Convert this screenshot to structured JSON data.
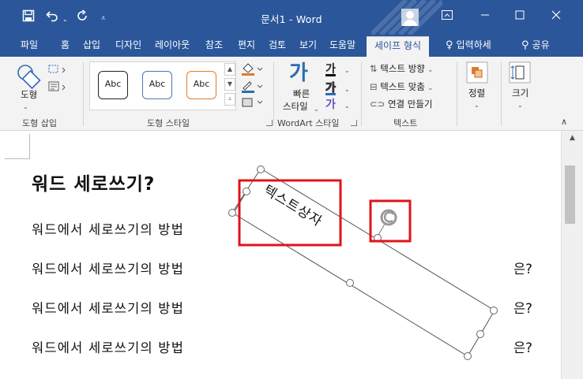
{
  "window": {
    "title": "문서1 - Word",
    "qat_icons": [
      "save-icon",
      "undo-icon",
      "redo-icon",
      "customize-qat-icon"
    ]
  },
  "tabs": [
    {
      "label": "파일"
    },
    {
      "label": "홈"
    },
    {
      "label": "삽입"
    },
    {
      "label": "디자인"
    },
    {
      "label": "레이아웃"
    },
    {
      "label": "참조"
    },
    {
      "label": "편지"
    },
    {
      "label": "검토"
    },
    {
      "label": "보기"
    },
    {
      "label": "도움말"
    },
    {
      "label": "세이프 형식",
      "active": true
    },
    {
      "label": "입력하세"
    },
    {
      "label": "공유"
    }
  ],
  "ribbon": {
    "insert_shapes": {
      "shape_label": "도형",
      "group_label": "도형 삽입"
    },
    "shape_styles": {
      "preset_labels": [
        "Abc",
        "Abc",
        "Abc"
      ],
      "group_label": "도형 스타일"
    },
    "wordart": {
      "quick_styles_label_line1": "빠른",
      "quick_styles_label_line2": "스타일",
      "text_fill_glyph": "가",
      "text_outline_glyph": "가",
      "text_effects_glyph": "가",
      "group_label": "WordArt 스타일"
    },
    "text": {
      "direction_label": "텍스트 방향",
      "align_label": "텍스트 맞춤",
      "link_label": "연결 만들기",
      "group_label": "텍스트"
    },
    "arrange_label": "정렬",
    "size_label": "크기"
  },
  "document": {
    "heading": "워드  세로쓰기?",
    "lines": [
      "워드에서  세로쓰기의  방법",
      "워드에서  세로쓰기의  방법",
      "워드에서  세로쓰기의  방법",
      "워드에서  세로쓰기의  방법"
    ],
    "trailing": [
      "은?",
      "은?",
      "은?"
    ],
    "textbox_text": "텍스트상자"
  },
  "colors": {
    "title_bar": "#2b579a",
    "ribbon_bg": "#f3f3f3",
    "highlight_red": "#e0131a"
  }
}
